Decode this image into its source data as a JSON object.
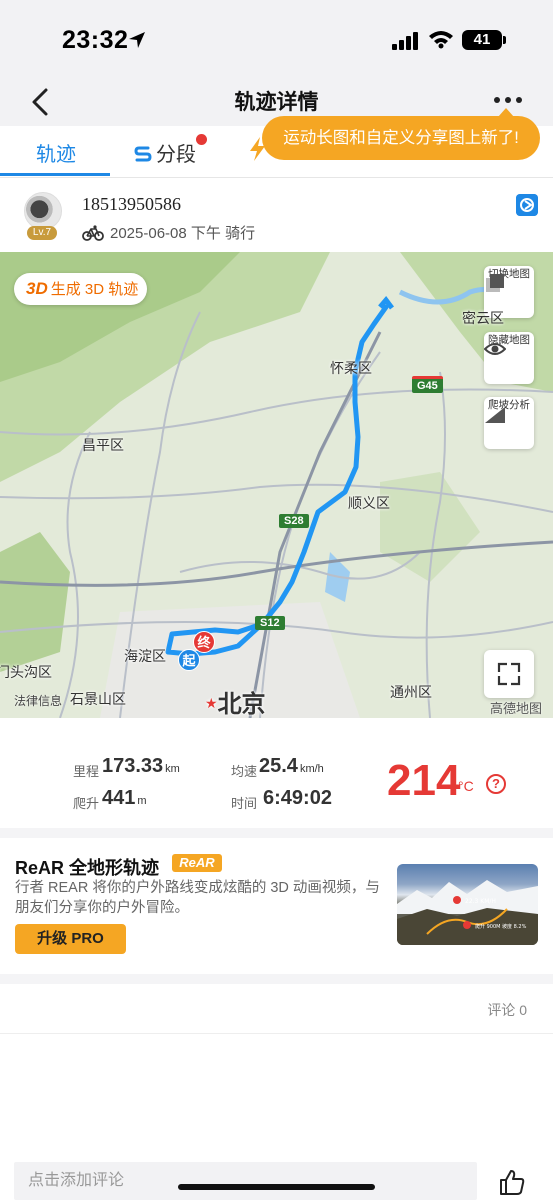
{
  "status_bar": {
    "time": "23:32",
    "battery": "41"
  },
  "nav": {
    "title": "轨迹详情"
  },
  "tabs": [
    {
      "label": "轨迹",
      "active": true
    },
    {
      "label": "分段",
      "has_dot": true
    }
  ],
  "tooltip": "运动长图和自定义分享图上新了!",
  "user": {
    "name": "18513950586",
    "level": "Lv.7",
    "date": "2025-06-08 下午",
    "sport": "骑行"
  },
  "map": {
    "btn_3d_icon": "3D",
    "btn_3d_label": "生成 3D 轨迹",
    "switch_label": "切换地图",
    "hide_label": "隐藏地图",
    "climb_label": "爬坡分析",
    "legal": "法律信息",
    "provider": "高德地图",
    "start_marker": "起",
    "end_marker": "终",
    "places": {
      "miyun": "密云区",
      "huairou": "怀柔区",
      "changping": "昌平区",
      "shunyi": "顺义区",
      "haidian": "海淀区",
      "mentougou": "门头沟区",
      "shijingshan": "石景山区",
      "beijing": "北京",
      "tongzhou": "通州区"
    },
    "road_shields": {
      "g45": "G45",
      "s28": "S28",
      "s12": "S12"
    }
  },
  "stats": {
    "distance_label": "里程",
    "distance": "173.33",
    "distance_unit": "km",
    "speed_label": "均速",
    "speed": "25.4",
    "speed_unit": "km/h",
    "climb_label": "爬升",
    "climb": "441",
    "climb_unit": "m",
    "time_label": "时间",
    "time": "6:49:02",
    "calories": "214",
    "calories_unit": "°C",
    "help": "?"
  },
  "rear": {
    "title": "ReAR 全地形轨迹",
    "badge": "ReAR",
    "desc": "行者 REAR 将你的户外路线变成炫酷的 3D 动画视频，与朋友们分享你的户外冒险。",
    "upgrade": "升级 PRO",
    "thumb_speed": "22.3 KM/H",
    "thumb_stats": "爬升 900M  坡度 8.2%"
  },
  "comments": {
    "count_label": "评论 0",
    "input_placeholder": "点击添加评论"
  },
  "colors": {
    "accent": "#1e88e5",
    "orange": "#f5a623",
    "calorie_red": "#e53935",
    "route": "#2196f3"
  }
}
